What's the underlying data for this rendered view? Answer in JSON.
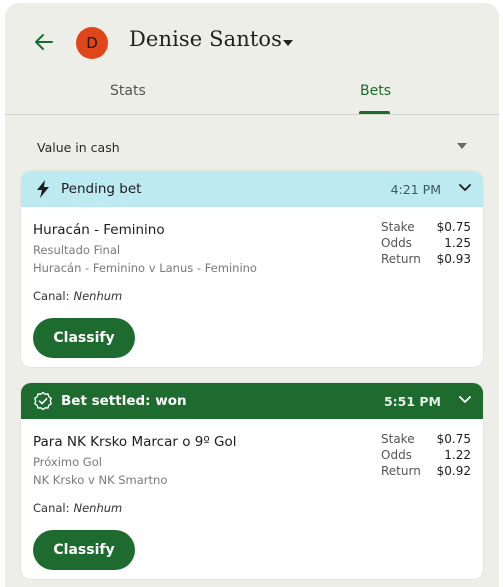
{
  "colors": {
    "brand_green": "#1e6b30",
    "pending_bg": "#bde9f1",
    "avatar_bg": "#e0461a",
    "panel_bg": "#edeee7"
  },
  "header": {
    "back_icon": "arrow-left-icon",
    "avatar_initial": "D",
    "user_name": "Denise Santos",
    "caret_icon": "caret-down-icon"
  },
  "tabs": [
    {
      "label": "Stats",
      "active": false
    },
    {
      "label": "Bets",
      "active": true
    }
  ],
  "value_select": {
    "label": "Value in cash",
    "icon": "caret-down-icon"
  },
  "bets": [
    {
      "status": "Pending bet",
      "status_icon": "lightning-icon",
      "time": "4:21 PM",
      "market": "Huracán - Feminino",
      "selection": "Resultado Final",
      "event": "Huracán - Feminino v Lanus - Feminino",
      "stake_label": "Stake",
      "stake": "$0.75",
      "odds_label": "Odds",
      "odds": "1.25",
      "return_label": "Return",
      "return": "$0.93",
      "canal_label": "Canal:",
      "canal": "Nenhum",
      "button": "Classify"
    },
    {
      "status": "Bet settled: won",
      "status_icon": "check-badge-icon",
      "time": "5:51 PM",
      "market": "Para NK Krsko Marcar o 9º Gol",
      "selection": "Próximo Gol",
      "event": "NK Krsko v NK Smartno",
      "stake_label": "Stake",
      "stake": "$0.75",
      "odds_label": "Odds",
      "odds": "1.22",
      "return_label": "Return",
      "return": "$0.92",
      "canal_label": "Canal:",
      "canal": "Nenhum",
      "button": "Classify"
    }
  ]
}
